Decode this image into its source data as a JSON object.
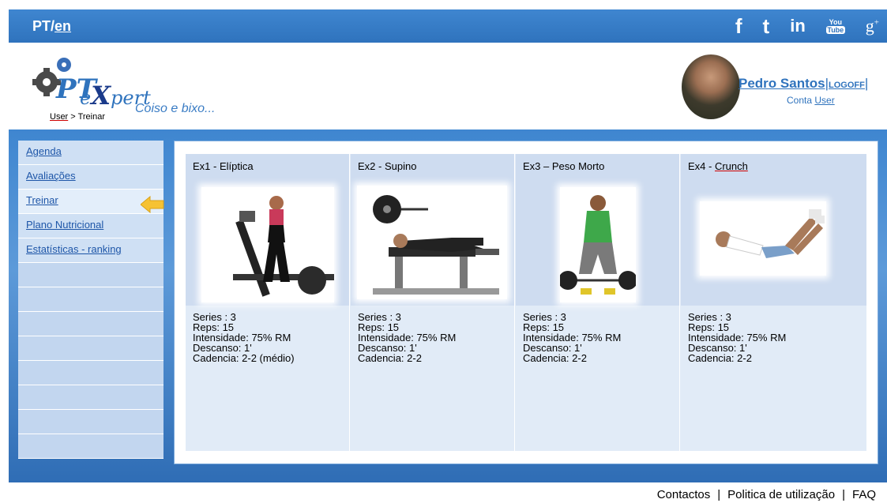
{
  "topbar": {
    "lang_pt": "PT/",
    "lang_en": "en",
    "social": {
      "facebook": "f",
      "twitter": "t",
      "linkedin": "in",
      "youtube_top": "You",
      "youtube_bottom": "Tube",
      "googleplus": "g",
      "googleplus_sup": "+"
    },
    "color": "#2f73bd"
  },
  "header": {
    "logo_text": "ert",
    "logo_prefix": "e",
    "logo_x": "X",
    "logo_p": "p",
    "slogan": "Coiso e bixo...",
    "breadcrumb_user": "User",
    "breadcrumb_rest": " > Treinar",
    "user_name": "Pedro Santos",
    "logoff": "LOGOFF",
    "conta_prefix": "Conta ",
    "conta_user": "User"
  },
  "sidebar": {
    "items": [
      {
        "label": "Agenda"
      },
      {
        "label": "Avaliações"
      },
      {
        "label": "Treinar"
      },
      {
        "label": "Plano Nutricional"
      },
      {
        "label": "Estatísticas - ranking"
      }
    ]
  },
  "exercises": [
    {
      "title": "Ex1 - Elíptica",
      "series": "Series : 3",
      "reps": "Reps: 15",
      "intensidade": "Intensidade: 75% RM",
      "descanso": "Descanso: 1'",
      "cadencia": "Cadencia: 2-2 (médio)"
    },
    {
      "title": "Ex2 - Supino",
      "series": "Series : 3",
      "reps": "Reps: 15",
      "intensidade": "Intensidade: 75% RM",
      "descanso": "Descanso: 1'",
      "cadencia": "Cadencia: 2-2"
    },
    {
      "title": "Ex3 – Peso Morto",
      "series": "Series : 3",
      "reps": "Reps: 15",
      "intensidade": "Intensidade: 75% RM",
      "descanso": "Descanso: 1'",
      "cadencia": "Cadencia: 2-2"
    },
    {
      "title_prefix": "Ex4 - ",
      "title_main": "Crunch",
      "series": "Series : 3",
      "reps": "Reps: 15",
      "intensidade": "Intensidade: 75% RM",
      "descanso": "Descanso: 1'",
      "cadencia": "Cadencia: 2-2"
    }
  ],
  "footer": {
    "contactos": "Contactos",
    "politica": "Politica de utilização",
    "faq": "FAQ",
    "separator": "|"
  }
}
